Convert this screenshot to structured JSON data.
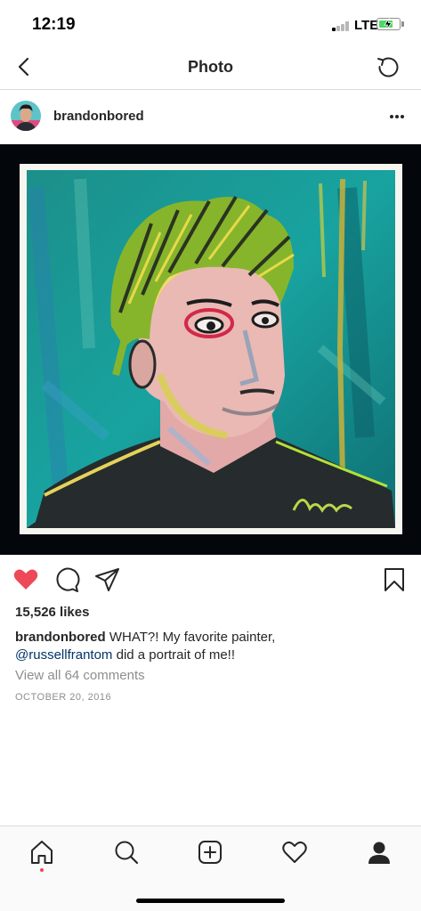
{
  "status_bar": {
    "time": "12:19",
    "network": "LTE",
    "battery_charging": true,
    "battery_color": "#4cd964"
  },
  "nav": {
    "title": "Photo",
    "back_icon": "chevron-left-icon",
    "refresh_icon": "refresh-icon"
  },
  "post": {
    "username": "brandonbored",
    "avatar_icon": "profile-avatar",
    "more_icon": "more-horizontal-icon",
    "photo_description_icon": "painted-portrait-image",
    "likes": "15,526 likes",
    "caption": {
      "username": "brandonbored",
      "text_before": "WHAT?! My favorite painter,",
      "mention": "@russellfrantom",
      "text_after": "did a portrait of me!!"
    },
    "view_comments": "View all 64 comments",
    "date": "OCTOBER 20, 2016",
    "liked": true,
    "like_color": "#ed4956",
    "mention_color": "#003569"
  },
  "actions": {
    "like_icon": "heart-filled-icon",
    "comment_icon": "comment-icon",
    "share_icon": "share-paper-plane-icon",
    "save_icon": "bookmark-icon"
  },
  "tab_bar": {
    "items": [
      {
        "name": "home",
        "icon": "home-icon",
        "active": true
      },
      {
        "name": "search",
        "icon": "search-icon"
      },
      {
        "name": "new-post",
        "icon": "plus-square-icon"
      },
      {
        "name": "activity",
        "icon": "heart-outline-icon",
        "has_notification": true
      },
      {
        "name": "profile",
        "icon": "profile-icon"
      }
    ]
  }
}
